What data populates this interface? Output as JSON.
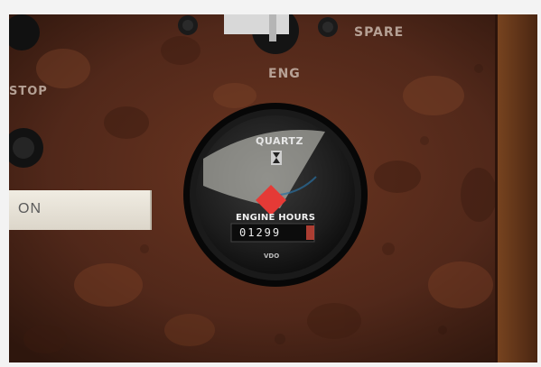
{
  "labels": {
    "spare": "SPARE",
    "eng": "ENG",
    "stop": "STOP"
  },
  "switch_plate": {
    "text": "ON"
  },
  "gauge": {
    "brand_top": "QUARTZ",
    "title": "ENGINE HOURS",
    "counter": "01299",
    "maker": "VDO"
  },
  "colors": {
    "wood": "#5a2c18",
    "gauge_bezel": "#0d0d0d",
    "warning_lamp": "#e53a36"
  }
}
